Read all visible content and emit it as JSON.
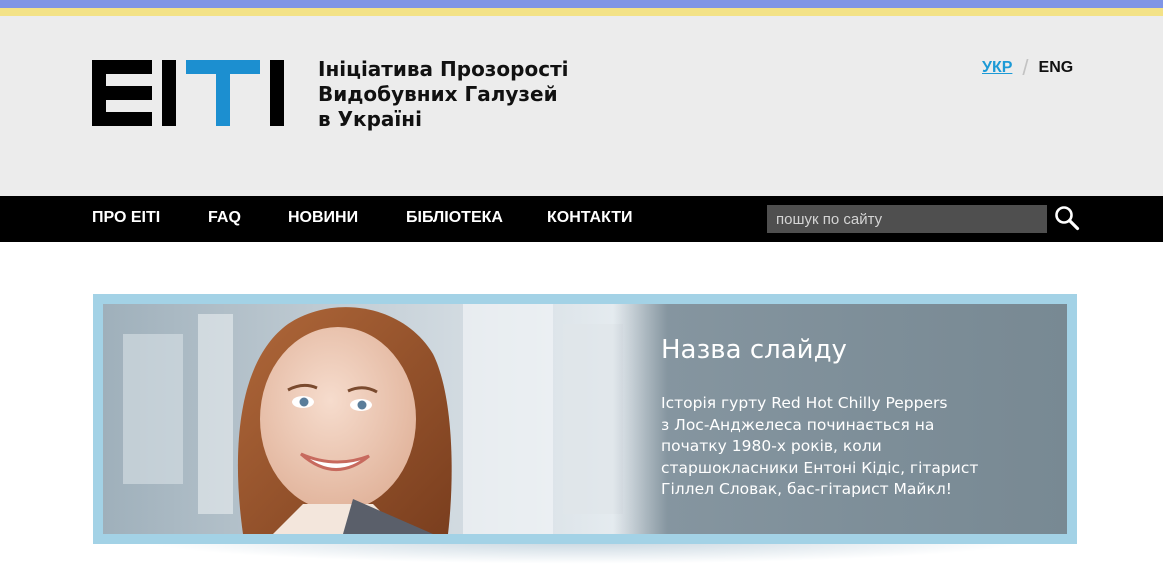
{
  "colors": {
    "stripe_top": "#7f95e6",
    "stripe_bottom": "#f3e287",
    "header_bg": "#ececec",
    "nav_bg": "#000000",
    "lang_active": "#1c9ad6",
    "logo_black": "#000000",
    "logo_blue": "#1c8fd0",
    "search_bg": "#4f4f4f",
    "slider_frame": "#a3d2e6",
    "slide_panel": "#7d8e99"
  },
  "logo": {
    "mark_text": "EITI",
    "title_lines": [
      "Ініціатива Прозорості",
      "Видобувних Галузей",
      "в Україні"
    ]
  },
  "lang": {
    "ukr": "УКР",
    "separator": "/",
    "eng": "ENG"
  },
  "nav": {
    "items": [
      {
        "label": "ПРО ЕІТІ"
      },
      {
        "label": "FAQ"
      },
      {
        "label": "НОВИНИ"
      },
      {
        "label": "БІБЛІОТЕКА"
      },
      {
        "label": "КОНТАКТИ"
      }
    ],
    "search_placeholder": "пошук по сайту",
    "search_icon": "search-icon"
  },
  "slide": {
    "title": "Назва слайду",
    "text_lines": [
      "Історія гурту Red Hot Chilly Peppers",
      "з Лос-Анджелеса починається на",
      "початку 1980-х років, коли",
      "старшокласники Ентоні Кідіс, гітарист",
      "Гіллел Словак, бас-гітарист Майкл!"
    ]
  }
}
